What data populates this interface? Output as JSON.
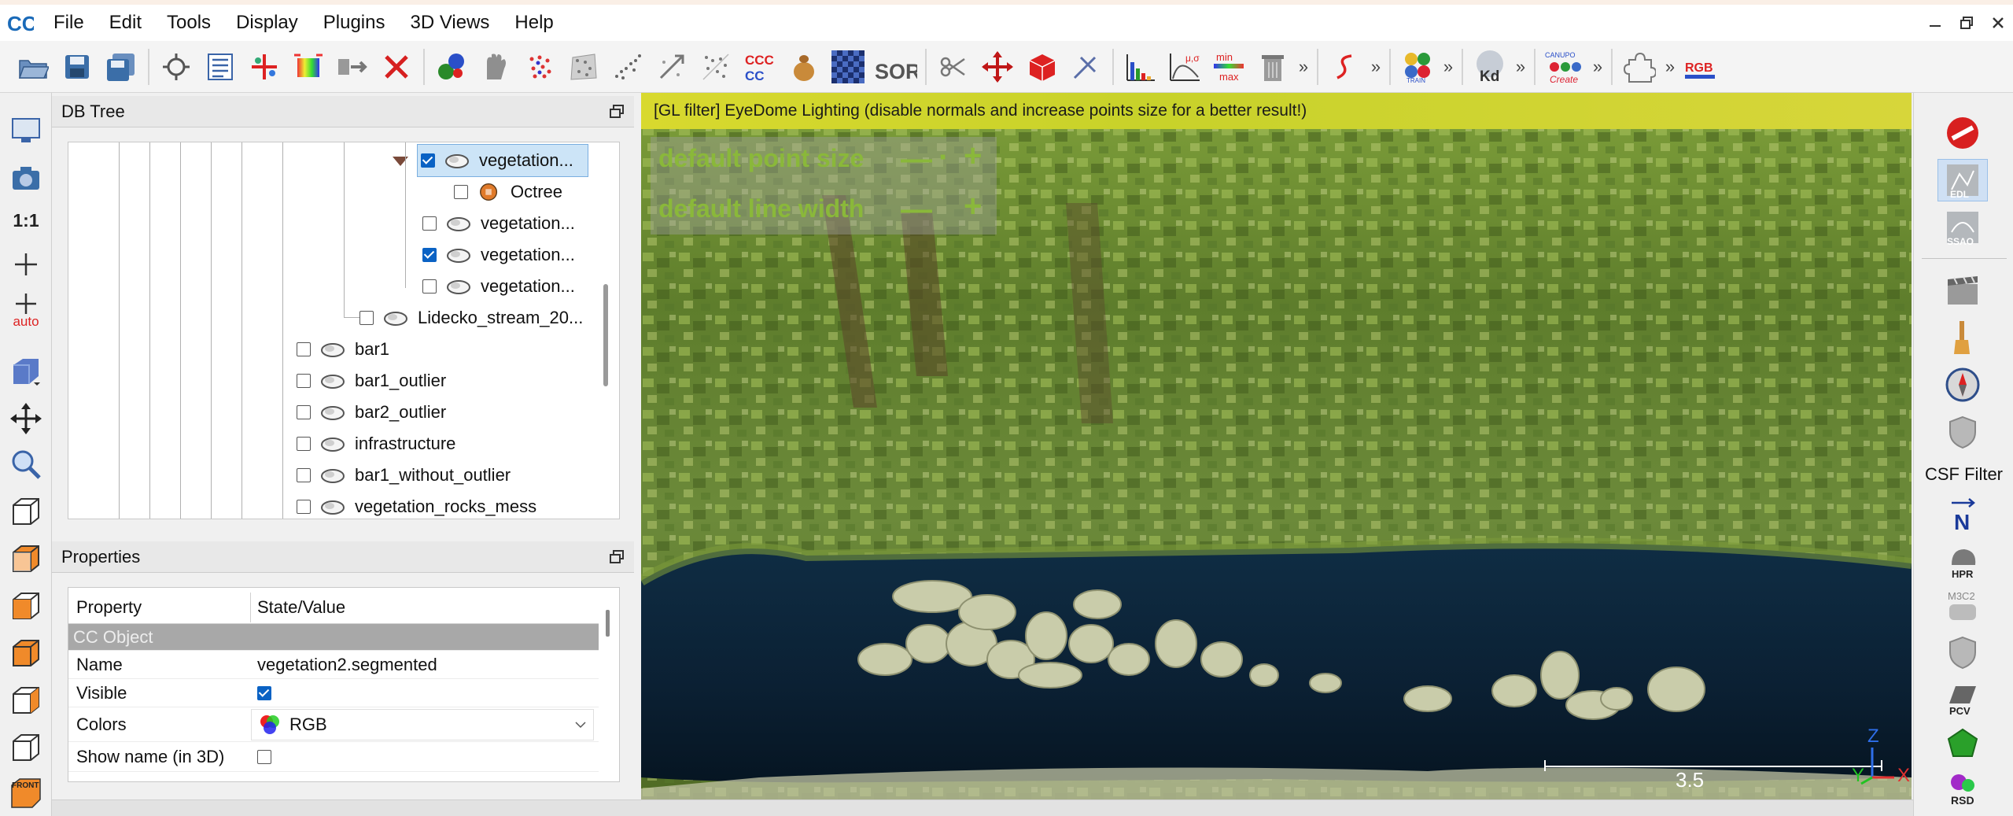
{
  "menu": {
    "items": [
      "File",
      "Edit",
      "Tools",
      "Display",
      "Plugins",
      "3D Views",
      "Help"
    ]
  },
  "toolbar": {
    "more_glyph": "»",
    "icons": [
      "open-icon",
      "save-icon",
      "save-all-icon",
      "clone-icon",
      "properties-list-icon",
      "translate-icon",
      "color-icon",
      "export-icon",
      "delete-icon",
      "merge-icon",
      "sample-icon",
      "subsample-icon",
      "noise-icon",
      "distance-icon",
      "compute-icon",
      "cloud2cloud-icon",
      "cloud-compare-icon",
      "bag-icon",
      "checker-icon",
      "sor-icon",
      "scissors-icon",
      "move-icon",
      "box-icon",
      "tool-icon",
      "histogram-icon",
      "stat-icon",
      "minmax-icon",
      "trash-icon",
      "spline-icon",
      "canupo-icon",
      "kd-icon",
      "canupo-create-icon",
      "puzzle-icon",
      "rgb-icon"
    ],
    "sor_label": "SOR",
    "ccc_label": "CCC",
    "mu_sigma_label": "μ,σ",
    "minmax_label": "min max",
    "kd_label": "Kd",
    "canupo_label": "CANUPO",
    "canupo_create_label": "Create",
    "train_label": "TRAIN",
    "rgb_label": "RGB"
  },
  "left_toolbar": {
    "one_to_one_label": "1:1",
    "auto_label": "auto",
    "front_label": "FRONT"
  },
  "right_toolbar": {
    "edl_label": "EDL",
    "ssao_label": "SSAO",
    "csf_label": "CSF Filter",
    "north_label": "N",
    "hpr_label": "HPR",
    "m3c2_label": "M3C2",
    "pcv_label": "PCV",
    "rsd_label": "RSD"
  },
  "db_tree": {
    "title": "DB Tree",
    "rows": [
      {
        "label": "vegetation...",
        "checked": true,
        "icon": "cloud-icon",
        "selected": true
      },
      {
        "label": "Octree",
        "checked": false,
        "icon": "octree-icon"
      },
      {
        "label": "vegetation...",
        "checked": false,
        "icon": "cloud-icon"
      },
      {
        "label": "vegetation...",
        "checked": true,
        "icon": "cloud-icon"
      },
      {
        "label": "vegetation...",
        "checked": false,
        "icon": "cloud-icon"
      },
      {
        "label": "Lidecko_stream_20...",
        "checked": false,
        "icon": "cloud-icon"
      },
      {
        "label": "bar1",
        "checked": false,
        "icon": "cloud-icon"
      },
      {
        "label": "bar1_outlier",
        "checked": false,
        "icon": "cloud-icon"
      },
      {
        "label": "bar2_outlier",
        "checked": false,
        "icon": "cloud-icon"
      },
      {
        "label": "infrastructure",
        "checked": false,
        "icon": "cloud-icon"
      },
      {
        "label": "bar1_without_outlier",
        "checked": false,
        "icon": "cloud-icon"
      },
      {
        "label": "vegetation_rocks_mess",
        "checked": false,
        "icon": "cloud-icon"
      }
    ]
  },
  "properties": {
    "title": "Properties",
    "col_property": "Property",
    "col_value": "State/Value",
    "section": "CC Object",
    "name_label": "Name",
    "name_value": "vegetation2.segmented",
    "visible_label": "Visible",
    "visible_checked": true,
    "colors_label": "Colors",
    "colors_value": "RGB",
    "show_name_label": "Show name (in 3D)",
    "show_name_checked": false
  },
  "viewport": {
    "gl_filter_text": "[GL filter] EyeDome Lighting (disable normals and increase points size for a better result!)",
    "point_size_label": "default point size",
    "line_width_label": "default line width",
    "minus_glyph": "—",
    "plus_glyph": "+",
    "dot_glyph": "·",
    "scale_value": "3.5",
    "axis_x": "X",
    "axis_y": "Y",
    "axis_z": "Z"
  },
  "colors": {
    "accent": "#0a62c4",
    "gl_bar": "#d8d92e",
    "overlay_text": "#8ab83a",
    "water": "#0c2438"
  }
}
